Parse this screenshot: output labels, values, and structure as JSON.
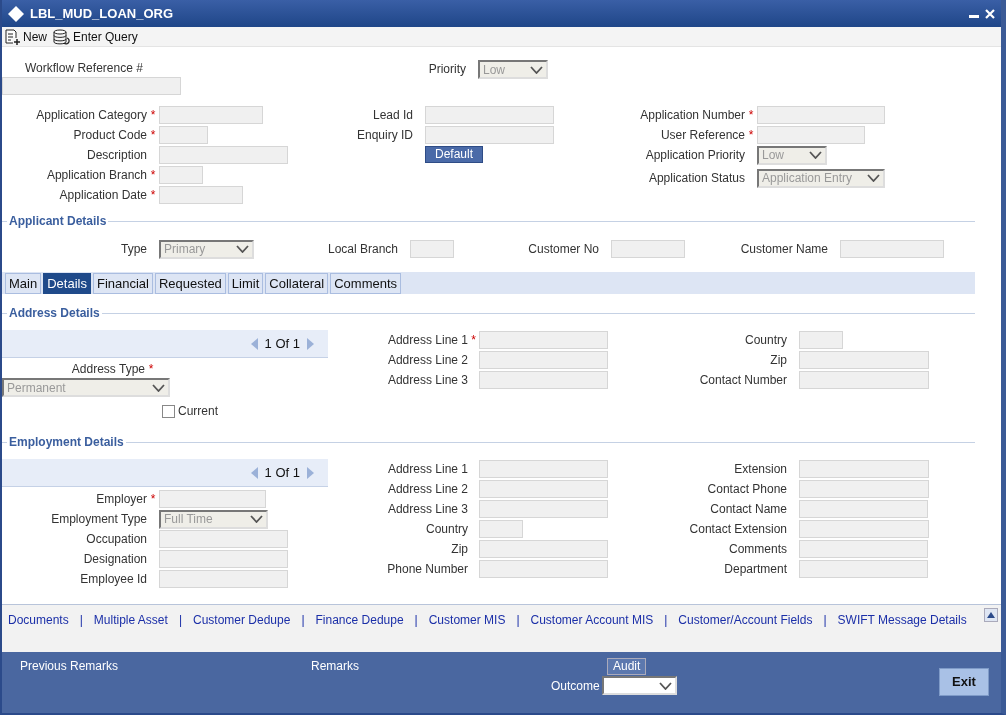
{
  "window": {
    "title": "LBL_MUD_LOAN_ORG"
  },
  "toolbar": [
    {
      "kind": "new",
      "label": "New"
    },
    {
      "kind": "query",
      "label": "Enter Query"
    }
  ],
  "header": {
    "workflow_reference": {
      "label": "Workflow Reference #"
    },
    "priority": {
      "label": "Priority",
      "kind": "select",
      "value": "Low"
    },
    "column_1": [
      {
        "label": "Application Category",
        "mark": "*",
        "kind": "text"
      },
      {
        "label": "Product Code",
        "mark": "*",
        "kind": "text"
      },
      {
        "label": "Description",
        "kind": "text"
      },
      {
        "label": "Application Branch",
        "mark": "*",
        "kind": "text"
      },
      {
        "label": "Application Date",
        "mark": "*",
        "kind": "text"
      }
    ],
    "column_2": [
      {
        "label": "Lead Id",
        "kind": "text"
      },
      {
        "label": "Enquiry ID",
        "kind": "text"
      }
    ],
    "default_button": "Default",
    "column_3": [
      {
        "label": "Application Number",
        "mark": "*",
        "kind": "text"
      },
      {
        "label": "User Reference",
        "mark": "*",
        "kind": "text"
      },
      {
        "label": "Application Priority",
        "kind": "select",
        "value": "Low"
      },
      {
        "label": "Application Status",
        "kind": "select",
        "value": "Application Entry"
      }
    ]
  },
  "applicant_details": {
    "title": "Applicant Details",
    "fields": [
      {
        "label": "Type",
        "kind": "select",
        "value": "Primary"
      },
      {
        "label": "Local Branch",
        "kind": "text"
      },
      {
        "label": "Customer No",
        "kind": "text"
      },
      {
        "label": "Customer Name",
        "kind": "text"
      }
    ]
  },
  "tabs": [
    {
      "label": "Main",
      "selected": false
    },
    {
      "label": "Details",
      "selected": true
    },
    {
      "label": "Financial",
      "selected": false
    },
    {
      "label": "Requested",
      "selected": false
    },
    {
      "label": "Limit",
      "selected": false
    },
    {
      "label": "Collateral",
      "selected": false
    },
    {
      "label": "Comments",
      "selected": false
    }
  ],
  "address_details": {
    "title": "Address Details",
    "pager": "1 Of 1",
    "address_type": {
      "label": "Address Type",
      "mark": "*",
      "kind": "select",
      "value": "Permanent"
    },
    "current": {
      "label": "Current",
      "checked": false
    },
    "column_2": [
      {
        "label": "Address Line 1",
        "mark": "*",
        "kind": "text"
      },
      {
        "label": "Address Line 2",
        "kind": "text"
      },
      {
        "label": "Address Line 3",
        "kind": "text"
      }
    ],
    "column_3": [
      {
        "label": "Country",
        "kind": "text"
      },
      {
        "label": "Zip",
        "kind": "text"
      },
      {
        "label": "Contact Number",
        "kind": "text"
      }
    ]
  },
  "employment_details": {
    "title": "Employment Details",
    "pager": "1 Of 1",
    "column_1": [
      {
        "label": "Employer",
        "mark": "*",
        "kind": "text"
      },
      {
        "label": "Employment Type",
        "kind": "select",
        "value": "Full Time"
      },
      {
        "label": "Occupation",
        "kind": "text"
      },
      {
        "label": "Designation",
        "kind": "text"
      },
      {
        "label": "Employee Id",
        "kind": "text"
      }
    ],
    "column_2": [
      {
        "label": "Address Line 1",
        "kind": "text"
      },
      {
        "label": "Address Line 2",
        "kind": "text"
      },
      {
        "label": "Address Line 3",
        "kind": "text"
      },
      {
        "label": "Country",
        "kind": "text"
      },
      {
        "label": "Zip",
        "kind": "text"
      },
      {
        "label": "Phone Number",
        "kind": "text"
      }
    ],
    "column_3": [
      {
        "label": "Extension",
        "kind": "text"
      },
      {
        "label": "Contact Phone",
        "kind": "text"
      },
      {
        "label": "Contact Name",
        "kind": "text"
      },
      {
        "label": "Contact Extension",
        "kind": "text"
      },
      {
        "label": "Comments",
        "kind": "text"
      },
      {
        "label": "Department",
        "kind": "text"
      }
    ]
  },
  "links": {
    "separator": "|",
    "items": [
      "Documents",
      "Multiple Asset",
      "Customer Dedupe",
      "Finance Dedupe",
      "Customer MIS",
      "Customer Account MIS",
      "Customer/Account Fields",
      "SWIFT Message Details"
    ]
  },
  "footer": {
    "previous_remarks": "Previous Remarks",
    "remarks": "Remarks",
    "audit_button": "Audit",
    "outcome": {
      "label": "Outcome",
      "kind": "select"
    },
    "exit_button": "Exit"
  }
}
